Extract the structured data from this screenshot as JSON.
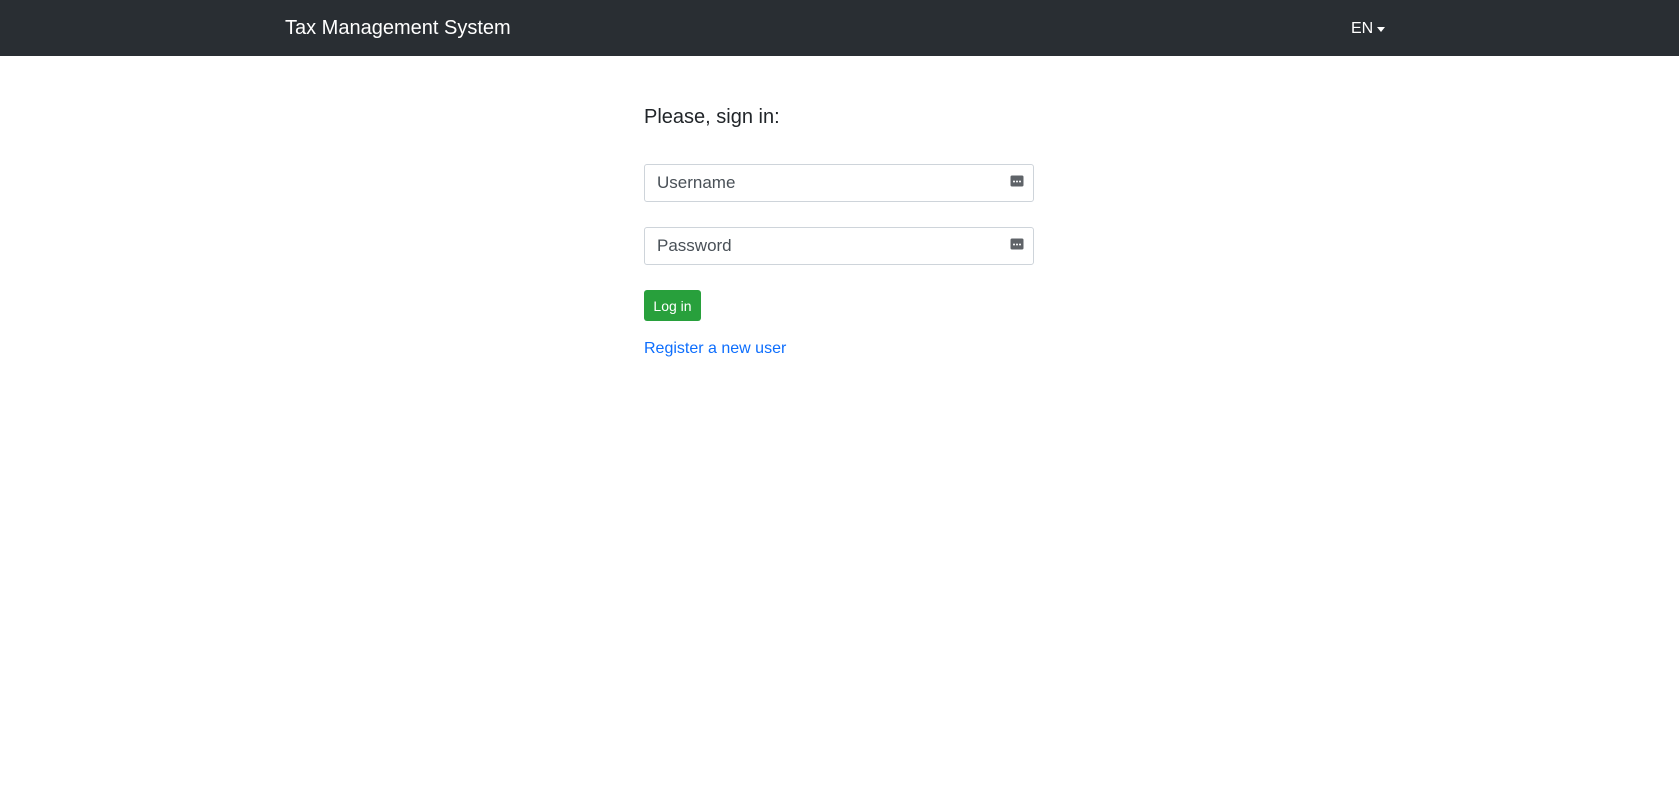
{
  "navbar": {
    "brand": "Tax Management System",
    "language": "EN"
  },
  "login_form": {
    "heading": "Please, sign in:",
    "username": {
      "placeholder": "Username",
      "value": ""
    },
    "password": {
      "placeholder": "Password",
      "value": ""
    },
    "submit_label": "Log in",
    "register_link": "Register a new user"
  },
  "icons": {
    "field_autofill": "password-manager-key-icon",
    "language_dropdown": "caret-down-icon"
  },
  "colors": {
    "navbar_bg": "#292e33",
    "primary_action": "#28a03c",
    "link": "#0d6efd",
    "input_border": "#ced4da"
  }
}
